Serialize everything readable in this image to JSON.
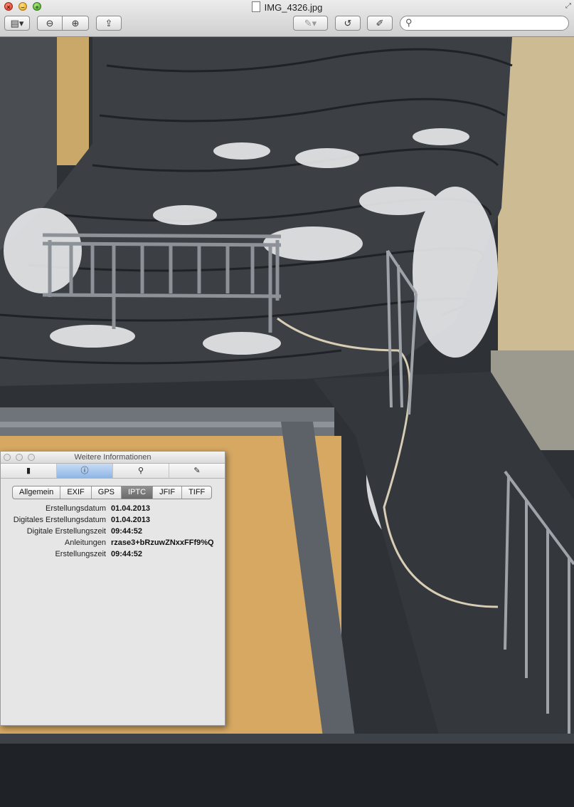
{
  "window": {
    "title": "IMG_4326.jpg",
    "traffic": {
      "close": "×",
      "minimize": "–",
      "zoom": "+"
    }
  },
  "toolbar": {
    "sidebar_glyph": "▤▾",
    "zoom_out_glyph": "⊖",
    "zoom_in_glyph": "⊕",
    "share_glyph": "⇪",
    "markup_glyph": "✎▾",
    "rotate_glyph": "↺",
    "edit_glyph": "✐",
    "search_placeholder": ""
  },
  "inspector": {
    "title": "Weitere Informationen",
    "section_icons": [
      "document-icon",
      "info-icon",
      "magnifier-icon",
      "pencil-icon"
    ],
    "section_glyphs": [
      "▮",
      "ⓘ",
      "⚲",
      "✎"
    ],
    "active_section": 1,
    "tabs": [
      {
        "label": "Allgemein"
      },
      {
        "label": "EXIF"
      },
      {
        "label": "GPS"
      },
      {
        "label": "IPTC"
      },
      {
        "label": "JFIF"
      },
      {
        "label": "TIFF"
      }
    ],
    "active_tab": 3,
    "rows": [
      {
        "label": "Erstellungsdatum",
        "value": "01.04.2013"
      },
      {
        "label": "Digitales Erstellungsdatum",
        "value": "01.04.2013"
      },
      {
        "label": "Digitale Erstellungszeit",
        "value": "09:44:52"
      },
      {
        "label": "Anleitungen",
        "value": "rzase3+bRzuwZNxxFFf9%Q"
      },
      {
        "label": "Erstellungszeit",
        "value": "09:44:52"
      }
    ]
  }
}
